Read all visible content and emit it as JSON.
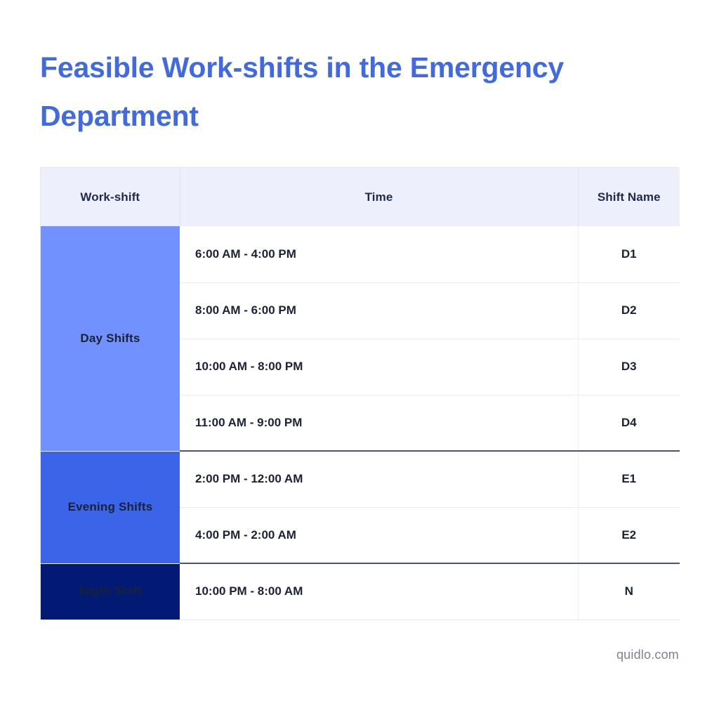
{
  "page": {
    "title": "Feasible Work-shifts in the Emergency Department",
    "watermark": "quidlo.com",
    "colors": {
      "title_blue": "#4169E1",
      "header_bg": "#EDEFFC",
      "header_text": "#1F2A4D",
      "day_shift_bg": "#7191FE",
      "evening_shift_bg": "#3A65E8",
      "night_shift_bg": "#031A74",
      "body_text": "#1B2233",
      "row_divider": "#ECEEF4",
      "group_divider": "#4B5578",
      "watermark_text": "#7B8494"
    }
  },
  "table": {
    "headers": {
      "workshift": "Work-shift",
      "time": "Time",
      "shift_name": "Shift Name"
    },
    "groups": [
      {
        "label": "Day Shifts",
        "rows": [
          {
            "time": "6:00 AM - 4:00 PM",
            "name": "D1"
          },
          {
            "time": "8:00 AM - 6:00 PM",
            "name": "D2"
          },
          {
            "time": "10:00 AM - 8:00 PM",
            "name": "D3"
          },
          {
            "time": "11:00 AM - 9:00 PM",
            "name": "D4"
          }
        ]
      },
      {
        "label": "Evening Shifts",
        "rows": [
          {
            "time": "2:00 PM - 12:00 AM",
            "name": "E1"
          },
          {
            "time": "4:00 PM - 2:00 AM",
            "name": "E2"
          }
        ]
      },
      {
        "label": "Night Shift",
        "rows": [
          {
            "time": "10:00 PM - 8:00 AM",
            "name": "N"
          }
        ]
      }
    ]
  }
}
